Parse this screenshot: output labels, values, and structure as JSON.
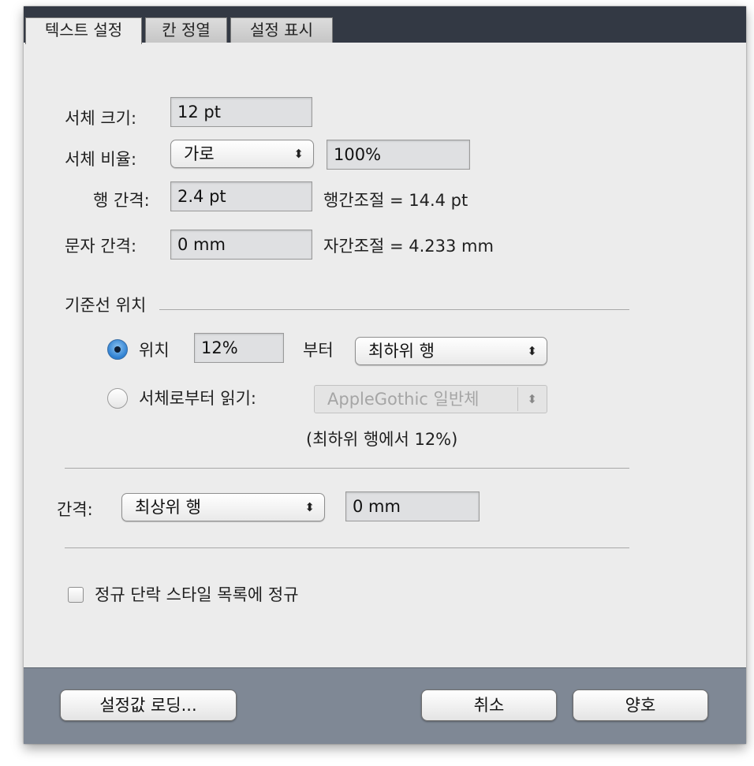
{
  "tabs": [
    {
      "label": "텍스트 설정"
    },
    {
      "label": "칸 정열"
    },
    {
      "label": "설정 표시"
    }
  ],
  "font_size": {
    "label": "서체 크기:",
    "value": "12 pt"
  },
  "font_ratio": {
    "label": "서체 비율:",
    "selected": "가로",
    "value": "100%"
  },
  "line_spacing": {
    "label": "행 간격:",
    "value": "2.4 pt",
    "info": "행간조절 = 14.4 pt"
  },
  "char_spacing": {
    "label": "문자 간격:",
    "value": "0 mm",
    "info": "자간조절 = 4.233 mm"
  },
  "baseline": {
    "section_label": "기준선 위치",
    "position_label": "위치",
    "position_value": "12%",
    "from_label": "부터",
    "from_selected": "최하위 행",
    "read_from_font_label": "서체로부터 읽기:",
    "font_selected": "AppleGothic 일반체",
    "note": "(최하위 행에서 12%)"
  },
  "gap": {
    "label": "간격:",
    "selected": "최상위 행",
    "value": "0 mm"
  },
  "checkbox": {
    "label": "정규 단락 스타일 목록에 정규",
    "checked": false
  },
  "buttons": {
    "load": "설정값 로딩...",
    "cancel": "취소",
    "ok": "양호"
  },
  "icons": {
    "popup_arrows": "⬍"
  }
}
